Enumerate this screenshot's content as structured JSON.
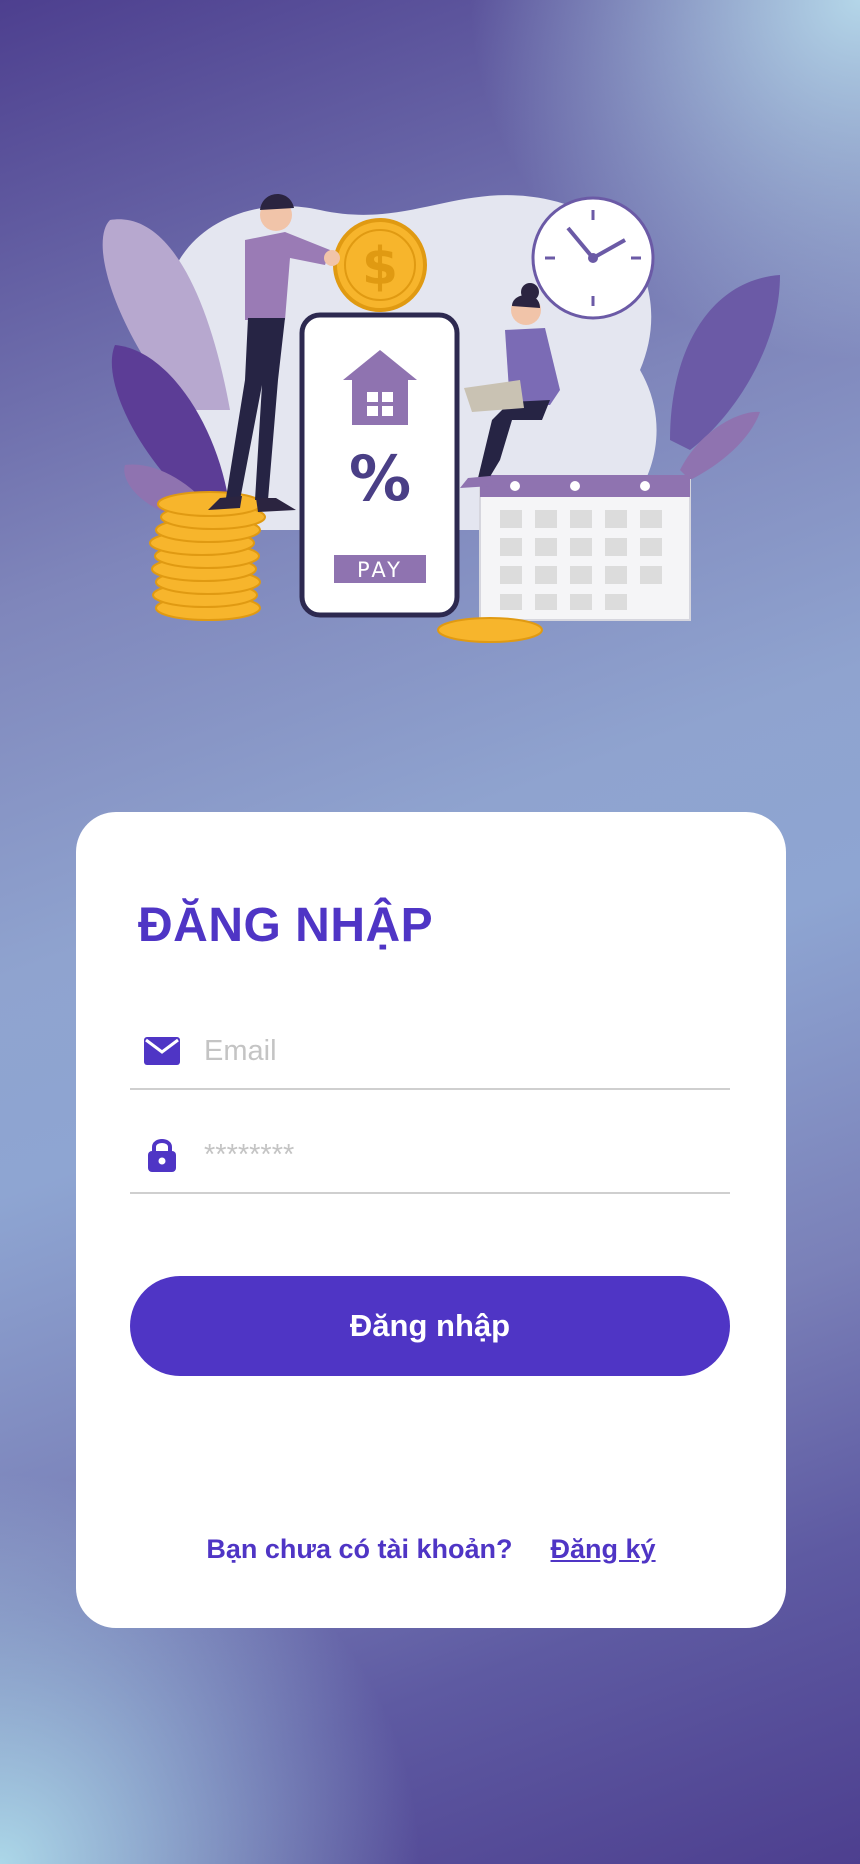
{
  "login": {
    "title": "ĐĂNG NHẬP",
    "email_placeholder": "Email",
    "password_placeholder": "********",
    "submit_label": "Đăng nhập",
    "signup_question": "Bạn chưa có tài khoản?",
    "signup_link": "Đăng ký"
  },
  "illustration": {
    "pay_text": "PAY",
    "percent_text": "%",
    "dollar_text": "$"
  },
  "icons": {
    "email": "mail-icon",
    "password": "lock-icon"
  },
  "colors": {
    "accent": "#4f35c5",
    "card": "#ffffff",
    "coin": "#f7b52c",
    "illustration_purple": "#8f73b0"
  }
}
